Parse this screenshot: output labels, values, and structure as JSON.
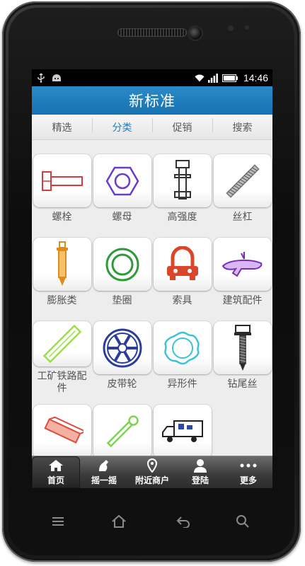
{
  "statusbar": {
    "time": "14:46",
    "icons": [
      "usb-icon",
      "android-icon",
      "wifi-icon",
      "signal-icon",
      "battery-icon"
    ]
  },
  "header": {
    "title": "新标准"
  },
  "tabs": [
    {
      "label": "精选",
      "active": false
    },
    {
      "label": "分类",
      "active": true
    },
    {
      "label": "促销",
      "active": false
    },
    {
      "label": "搜索",
      "active": false
    }
  ],
  "categories": [
    {
      "label": "螺栓",
      "icon": "bolt-icon",
      "color": "#d93a3a"
    },
    {
      "label": "螺母",
      "icon": "hex-nut-icon",
      "color": "#6a3cc8"
    },
    {
      "label": "高强度",
      "icon": "high-strength-bolt-icon",
      "color": "#333333"
    },
    {
      "label": "丝杠",
      "icon": "threaded-rod-icon",
      "color": "#777777"
    },
    {
      "label": "膨胀类",
      "icon": "expansion-anchor-icon",
      "color": "#e08a1e"
    },
    {
      "label": "垫圈",
      "icon": "washer-icon",
      "color": "#2f9a3a"
    },
    {
      "label": "索具",
      "icon": "rigging-clamp-icon",
      "color": "#d9462a"
    },
    {
      "label": "建筑配件",
      "icon": "building-fitting-icon",
      "color": "#7a2fb0"
    },
    {
      "label": "工矿铁路配件",
      "icon": "rail-part-icon",
      "color": "#9be04a"
    },
    {
      "label": "皮带轮",
      "icon": "pulley-icon",
      "color": "#2a3d9a"
    },
    {
      "label": "异形件",
      "icon": "special-shaped-part-icon",
      "color": "#3cc2d8"
    },
    {
      "label": "钻尾丝",
      "icon": "self-drilling-screw-icon",
      "color": "#2a2a2a"
    },
    {
      "label": "",
      "icon": "block-icon",
      "color": "#e04a3a"
    },
    {
      "label": "",
      "icon": "wrench-icon",
      "color": "#7ad84a"
    },
    {
      "label": "",
      "icon": "truck-icon",
      "color": "#2a4ab0"
    }
  ],
  "bottom_nav": [
    {
      "label": "首页",
      "icon": "home-icon",
      "active": true
    },
    {
      "label": "摇一摇",
      "icon": "shake-icon",
      "active": false
    },
    {
      "label": "附近商户",
      "icon": "location-pin-icon",
      "active": false
    },
    {
      "label": "登陆",
      "icon": "user-icon",
      "active": false
    },
    {
      "label": "更多",
      "icon": "more-dots-icon",
      "active": false
    }
  ],
  "hardware_keys": [
    "menu-icon",
    "home-outline-icon",
    "back-icon",
    "search-icon"
  ]
}
